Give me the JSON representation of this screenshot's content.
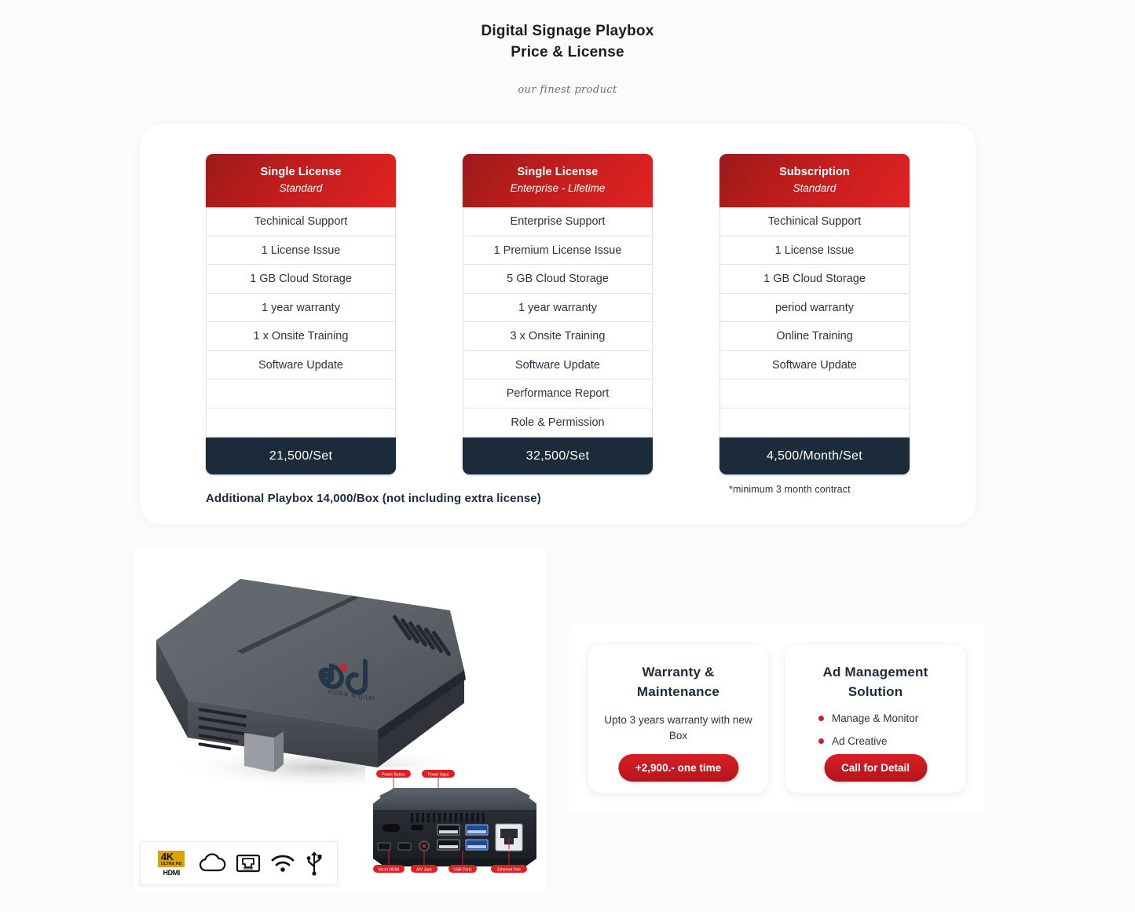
{
  "header": {
    "title_line1": "Digital Signage Playbox",
    "title_line2": "Price & License",
    "tagline": "our finest product"
  },
  "pricing": {
    "footnote": "Additional Playbox 14,000/Box (not including extra license)",
    "cards": [
      {
        "plan": "Single License",
        "tier": "Standard",
        "features": [
          "Techinical Support",
          "1 License Issue",
          "1 GB Cloud Storage",
          "1 year warranty",
          "1 x Onsite Training",
          "Software Update",
          "",
          ""
        ],
        "price": "21,500/Set",
        "note": ""
      },
      {
        "plan": "Single License",
        "tier": "Enterprise - Lifetime",
        "features": [
          "Enterprise Support",
          "1 Premium License Issue",
          "5 GB Cloud Storage",
          "1 year warranty",
          "3 x Onsite Training",
          "Software Update",
          "Performance Report",
          "Role & Permission"
        ],
        "price": "32,500/Set",
        "note": ""
      },
      {
        "plan": "Subscription",
        "tier": "Standard",
        "features": [
          "Techinical Support",
          "1 License Issue",
          "1 GB Cloud Storage",
          "period warranty",
          "Online Training",
          "Software Update",
          "",
          ""
        ],
        "price": "4,500/Month/Set",
        "note": "*minimum 3 month contract"
      }
    ]
  },
  "product": {
    "logo_mark": "a·d",
    "logo_sub": "alpha digital",
    "rear_labels_top": [
      "Power Button",
      "Power Input"
    ],
    "rear_labels_bottom": [
      "Micro HDMI",
      "A/V Jack",
      "USB Ports",
      "Ethernet Port"
    ],
    "spec_icons": [
      {
        "name": "4k-ultra-hd-hdmi-icon",
        "top": "4K",
        "top_sub": "ULTRA HD",
        "bottom": "HDMI"
      },
      {
        "name": "cloud-icon"
      },
      {
        "name": "ethernet-port-icon"
      },
      {
        "name": "wifi-icon"
      },
      {
        "name": "usb-icon"
      }
    ]
  },
  "info": {
    "warranty": {
      "title": "Warranty & Maintenance",
      "desc": "Upto 3 years warranty with new Box",
      "button": "+2,900.- one time"
    },
    "ad_management": {
      "title": "Ad Management Solution",
      "bullets": [
        "Manage & Monitor",
        "Ad Creative"
      ],
      "button": "Call for Detail"
    }
  },
  "colors": {
    "brand_red": "#cf1d2a",
    "header_red_dark": "#9c1a1a",
    "header_red_light": "#e22222",
    "footer_navy": "#1c2b3a",
    "page_bg": "#fbfbfb"
  }
}
